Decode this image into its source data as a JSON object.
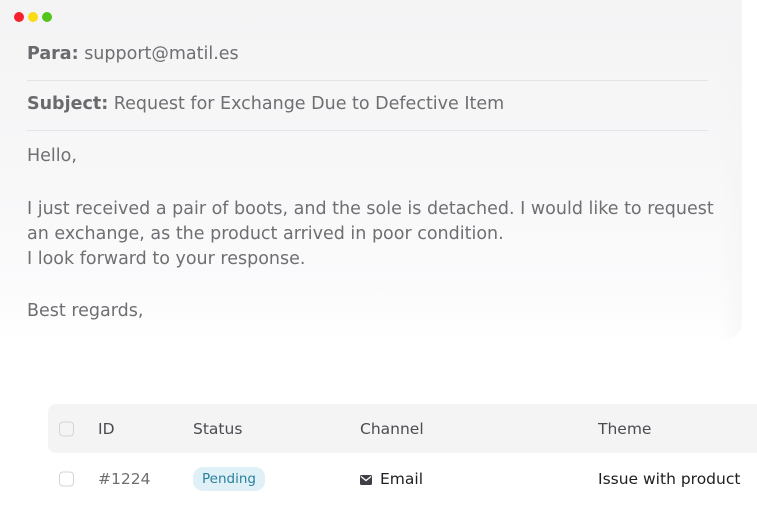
{
  "window": {
    "controls": {
      "close_color": "#f5222d",
      "minimize_color": "#fadb14",
      "zoom_color": "#52c41a"
    }
  },
  "email": {
    "to_label": "Para:",
    "to_value": "support@matil.es",
    "subject_label": "Subject:",
    "subject_value": "Request for Exchange Due to Defective Item",
    "greeting": "Hello,",
    "body_lines": [
      "I just received a pair of boots, and the sole is detached. I would like to request",
      "an exchange, as the product arrived in poor condition.",
      "I look forward to your response."
    ],
    "closing": "Best regards,"
  },
  "table": {
    "headers": {
      "id": "ID",
      "status": "Status",
      "channel": "Channel",
      "theme": "Theme"
    },
    "rows": [
      {
        "id": "#1224",
        "status": "Pending",
        "channel_icon": "mail-icon",
        "channel": "Email",
        "theme": "Issue with product"
      }
    ]
  },
  "colors": {
    "badge_bg": "#dff1f7",
    "badge_text": "#2a7f9e",
    "header_bg": "#f4f4f5"
  }
}
